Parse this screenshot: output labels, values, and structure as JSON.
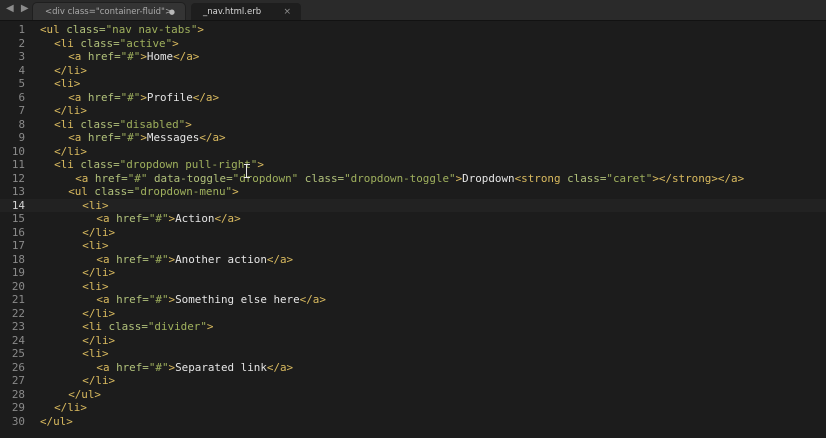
{
  "tabs": [
    {
      "label": "<div class=\"container-fluid\">",
      "close_glyph": "●"
    },
    {
      "label": "_nav.html.erb",
      "close_glyph": "×"
    }
  ],
  "editor": {
    "current_line": 14,
    "lines": [
      {
        "n": "1",
        "indent": 0,
        "tokens": [
          {
            "c": "t",
            "v": "<ul "
          },
          {
            "c": "a",
            "v": "class="
          },
          {
            "c": "s",
            "v": "\"nav nav-tabs\""
          },
          {
            "c": "t",
            "v": ">"
          }
        ]
      },
      {
        "n": "2",
        "indent": 2,
        "tokens": [
          {
            "c": "t",
            "v": "<li "
          },
          {
            "c": "a",
            "v": "class="
          },
          {
            "c": "s",
            "v": "\"active\""
          },
          {
            "c": "t",
            "v": ">"
          }
        ]
      },
      {
        "n": "3",
        "indent": 4,
        "tokens": [
          {
            "c": "t",
            "v": "<a "
          },
          {
            "c": "a",
            "v": "href="
          },
          {
            "c": "s",
            "v": "\"#\""
          },
          {
            "c": "t",
            "v": ">"
          },
          {
            "c": "x",
            "v": "Home"
          },
          {
            "c": "t",
            "v": "</a>"
          }
        ]
      },
      {
        "n": "4",
        "indent": 2,
        "tokens": [
          {
            "c": "t",
            "v": "</li>"
          }
        ]
      },
      {
        "n": "5",
        "indent": 2,
        "tokens": [
          {
            "c": "t",
            "v": "<li>"
          }
        ]
      },
      {
        "n": "6",
        "indent": 4,
        "tokens": [
          {
            "c": "t",
            "v": "<a "
          },
          {
            "c": "a",
            "v": "href="
          },
          {
            "c": "s",
            "v": "\"#\""
          },
          {
            "c": "t",
            "v": ">"
          },
          {
            "c": "x",
            "v": "Profile"
          },
          {
            "c": "t",
            "v": "</a>"
          }
        ]
      },
      {
        "n": "7",
        "indent": 2,
        "tokens": [
          {
            "c": "t",
            "v": "</li>"
          }
        ]
      },
      {
        "n": "8",
        "indent": 2,
        "tokens": [
          {
            "c": "t",
            "v": "<li "
          },
          {
            "c": "a",
            "v": "class="
          },
          {
            "c": "s",
            "v": "\"disabled\""
          },
          {
            "c": "t",
            "v": ">"
          }
        ]
      },
      {
        "n": "9",
        "indent": 4,
        "tokens": [
          {
            "c": "t",
            "v": "<a "
          },
          {
            "c": "a",
            "v": "href="
          },
          {
            "c": "s",
            "v": "\"#\""
          },
          {
            "c": "t",
            "v": ">"
          },
          {
            "c": "x",
            "v": "Messages"
          },
          {
            "c": "t",
            "v": "</a>"
          }
        ]
      },
      {
        "n": "10",
        "indent": 2,
        "tokens": [
          {
            "c": "t",
            "v": "</li>"
          }
        ]
      },
      {
        "n": "11",
        "indent": 2,
        "tokens": [
          {
            "c": "t",
            "v": "<li "
          },
          {
            "c": "a",
            "v": "class="
          },
          {
            "c": "s",
            "v": "\"dropdown pull-right\""
          },
          {
            "c": "t",
            "v": ">"
          }
        ]
      },
      {
        "n": "12",
        "indent": 5,
        "tokens": [
          {
            "c": "t",
            "v": "<a "
          },
          {
            "c": "a",
            "v": "href="
          },
          {
            "c": "s",
            "v": "\"#\" "
          },
          {
            "c": "a",
            "v": "data-toggle="
          },
          {
            "c": "s",
            "v": "\"dropdown\" "
          },
          {
            "c": "a",
            "v": "class="
          },
          {
            "c": "s",
            "v": "\"dropdown-toggle\""
          },
          {
            "c": "t",
            "v": ">"
          },
          {
            "c": "x",
            "v": "Dropdown"
          },
          {
            "c": "t",
            "v": "<strong "
          },
          {
            "c": "a",
            "v": "class="
          },
          {
            "c": "s",
            "v": "\"caret\""
          },
          {
            "c": "t",
            "v": "></strong></a>"
          }
        ]
      },
      {
        "n": "13",
        "indent": 4,
        "tokens": [
          {
            "c": "t",
            "v": "<ul "
          },
          {
            "c": "a",
            "v": "class="
          },
          {
            "c": "s",
            "v": "\"dropdown-menu\""
          },
          {
            "c": "t",
            "v": ">"
          }
        ]
      },
      {
        "n": "14",
        "indent": 6,
        "tokens": [
          {
            "c": "t",
            "v": "<li>"
          }
        ]
      },
      {
        "n": "15",
        "indent": 8,
        "tokens": [
          {
            "c": "t",
            "v": "<a "
          },
          {
            "c": "a",
            "v": "href="
          },
          {
            "c": "s",
            "v": "\"#\""
          },
          {
            "c": "t",
            "v": ">"
          },
          {
            "c": "x",
            "v": "Action"
          },
          {
            "c": "t",
            "v": "</a>"
          }
        ]
      },
      {
        "n": "16",
        "indent": 6,
        "tokens": [
          {
            "c": "t",
            "v": "</li>"
          }
        ]
      },
      {
        "n": "17",
        "indent": 6,
        "tokens": [
          {
            "c": "t",
            "v": "<li>"
          }
        ]
      },
      {
        "n": "18",
        "indent": 8,
        "tokens": [
          {
            "c": "t",
            "v": "<a "
          },
          {
            "c": "a",
            "v": "href="
          },
          {
            "c": "s",
            "v": "\"#\""
          },
          {
            "c": "t",
            "v": ">"
          },
          {
            "c": "x",
            "v": "Another action"
          },
          {
            "c": "t",
            "v": "</a>"
          }
        ]
      },
      {
        "n": "19",
        "indent": 6,
        "tokens": [
          {
            "c": "t",
            "v": "</li>"
          }
        ]
      },
      {
        "n": "20",
        "indent": 6,
        "tokens": [
          {
            "c": "t",
            "v": "<li>"
          }
        ]
      },
      {
        "n": "21",
        "indent": 8,
        "tokens": [
          {
            "c": "t",
            "v": "<a "
          },
          {
            "c": "a",
            "v": "href="
          },
          {
            "c": "s",
            "v": "\"#\""
          },
          {
            "c": "t",
            "v": ">"
          },
          {
            "c": "x",
            "v": "Something else here"
          },
          {
            "c": "t",
            "v": "</a>"
          }
        ]
      },
      {
        "n": "22",
        "indent": 6,
        "tokens": [
          {
            "c": "t",
            "v": "</li>"
          }
        ]
      },
      {
        "n": "23",
        "indent": 6,
        "tokens": [
          {
            "c": "t",
            "v": "<li "
          },
          {
            "c": "a",
            "v": "class="
          },
          {
            "c": "s",
            "v": "\"divider\""
          },
          {
            "c": "t",
            "v": ">"
          }
        ]
      },
      {
        "n": "24",
        "indent": 6,
        "tokens": [
          {
            "c": "t",
            "v": "</li>"
          }
        ]
      },
      {
        "n": "25",
        "indent": 6,
        "tokens": [
          {
            "c": "t",
            "v": "<li>"
          }
        ]
      },
      {
        "n": "26",
        "indent": 8,
        "tokens": [
          {
            "c": "t",
            "v": "<a "
          },
          {
            "c": "a",
            "v": "href="
          },
          {
            "c": "s",
            "v": "\"#\""
          },
          {
            "c": "t",
            "v": ">"
          },
          {
            "c": "x",
            "v": "Separated link"
          },
          {
            "c": "t",
            "v": "</a>"
          }
        ]
      },
      {
        "n": "27",
        "indent": 6,
        "tokens": [
          {
            "c": "t",
            "v": "</li>"
          }
        ]
      },
      {
        "n": "28",
        "indent": 4,
        "tokens": [
          {
            "c": "t",
            "v": "</ul>"
          }
        ]
      },
      {
        "n": "29",
        "indent": 2,
        "tokens": [
          {
            "c": "t",
            "v": "</li>"
          }
        ]
      },
      {
        "n": "30",
        "indent": 0,
        "tokens": [
          {
            "c": "t",
            "v": "</ul>"
          }
        ]
      }
    ]
  },
  "colors": {
    "tag": "#d9ba5f",
    "attribute": "#b0c07a",
    "string": "#9fb05d",
    "text": "#e4e4e4",
    "background": "#1c1c1c"
  }
}
